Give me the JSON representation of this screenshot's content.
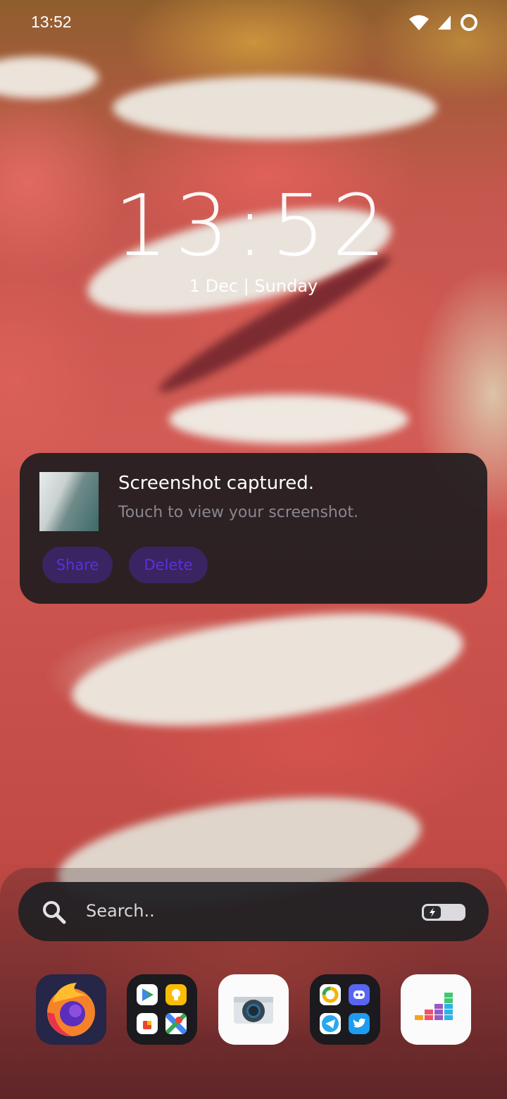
{
  "status_bar": {
    "time": "13:52",
    "icons": [
      "wifi-icon",
      "cell-signal-icon",
      "battery-ring-icon"
    ]
  },
  "lockscreen": {
    "clock": "13:52",
    "date": "1 Dec | Sunday"
  },
  "notification": {
    "title": "Screenshot captured.",
    "subtitle": "Touch to view your screenshot.",
    "actions": [
      "Share",
      "Delete"
    ],
    "accent_color": "#5a2fe3"
  },
  "search": {
    "placeholder": "Search.."
  },
  "dock": {
    "apps": [
      "firefox-icon",
      "google-folder-icon",
      "camera-icon",
      "social-folder-icon",
      "deezer-icon"
    ]
  }
}
